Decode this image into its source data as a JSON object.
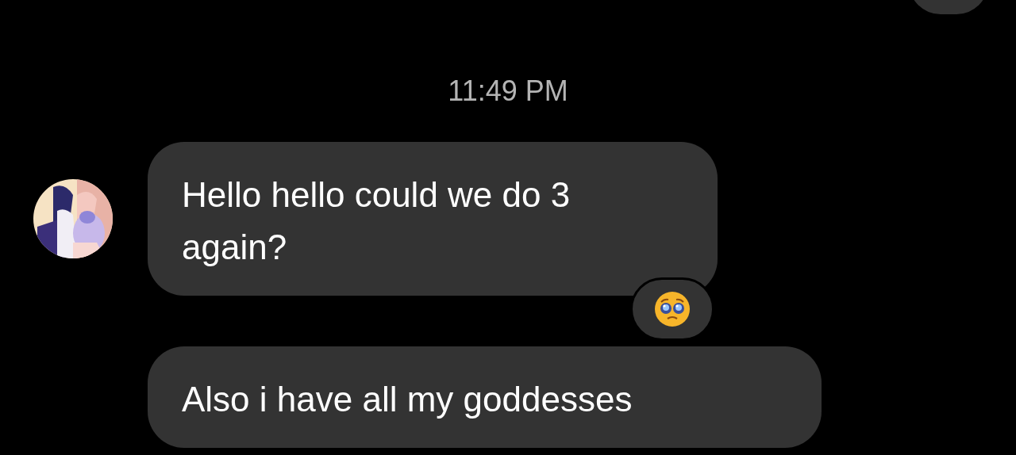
{
  "messages_above": [
    {
      "kind": "outgoing_cut"
    }
  ],
  "timestamp": "11:49 PM",
  "messages": [
    {
      "text": "Hello hello could we do 3 again?",
      "reaction": {
        "kind": "pleading_face"
      }
    },
    {
      "text": "Also i have all my goddesses"
    }
  ]
}
